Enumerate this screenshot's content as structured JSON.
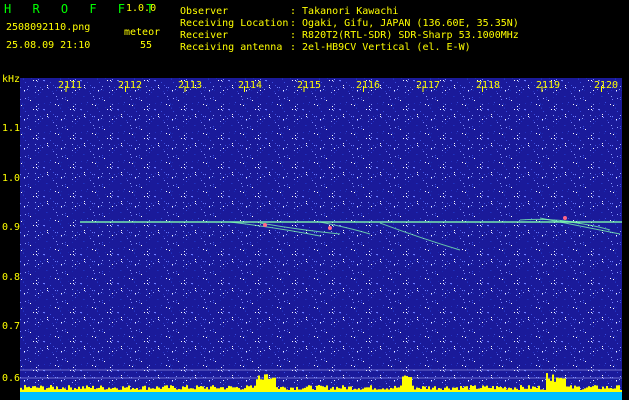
{
  "header": {
    "logo": "H R O F F T",
    "version": "1.0.0",
    "filename": "2508092110.png",
    "datetime": "25.08.09 21:10",
    "meteor_label": "meteor",
    "meteor_count": "55",
    "observer_key": "Observer",
    "observer_val": ": Takanori Kawachi",
    "location_key": "Receiving Location",
    "location_val": ": Ogaki, Gifu, JAPAN (136.60E, 35.35N)",
    "receiver_key": "Receiver",
    "receiver_val": ": R820T2(RTL-SDR) SDR-Sharp 53.1000MHz",
    "antenna_key": "Receiving antenna",
    "antenna_val": ": 2el-HB9CV Vertical (el. E-W)"
  },
  "axis": {
    "y_unit": "kHz",
    "y_ticks": [
      "1.1",
      "1.0",
      "0.9",
      "0.8",
      "0.7",
      "0.6"
    ],
    "x_ticks": [
      "2111",
      "2112",
      "2113",
      "2114",
      "2115",
      "2116",
      "2117",
      "2118",
      "2119",
      "2120"
    ]
  },
  "colors": {
    "background": "#1a1a9a",
    "label": "#ffff00",
    "logo": "#00ff00",
    "trace": "#80ffb0",
    "bars": "#ffff00",
    "floor": "#00bfff"
  }
}
